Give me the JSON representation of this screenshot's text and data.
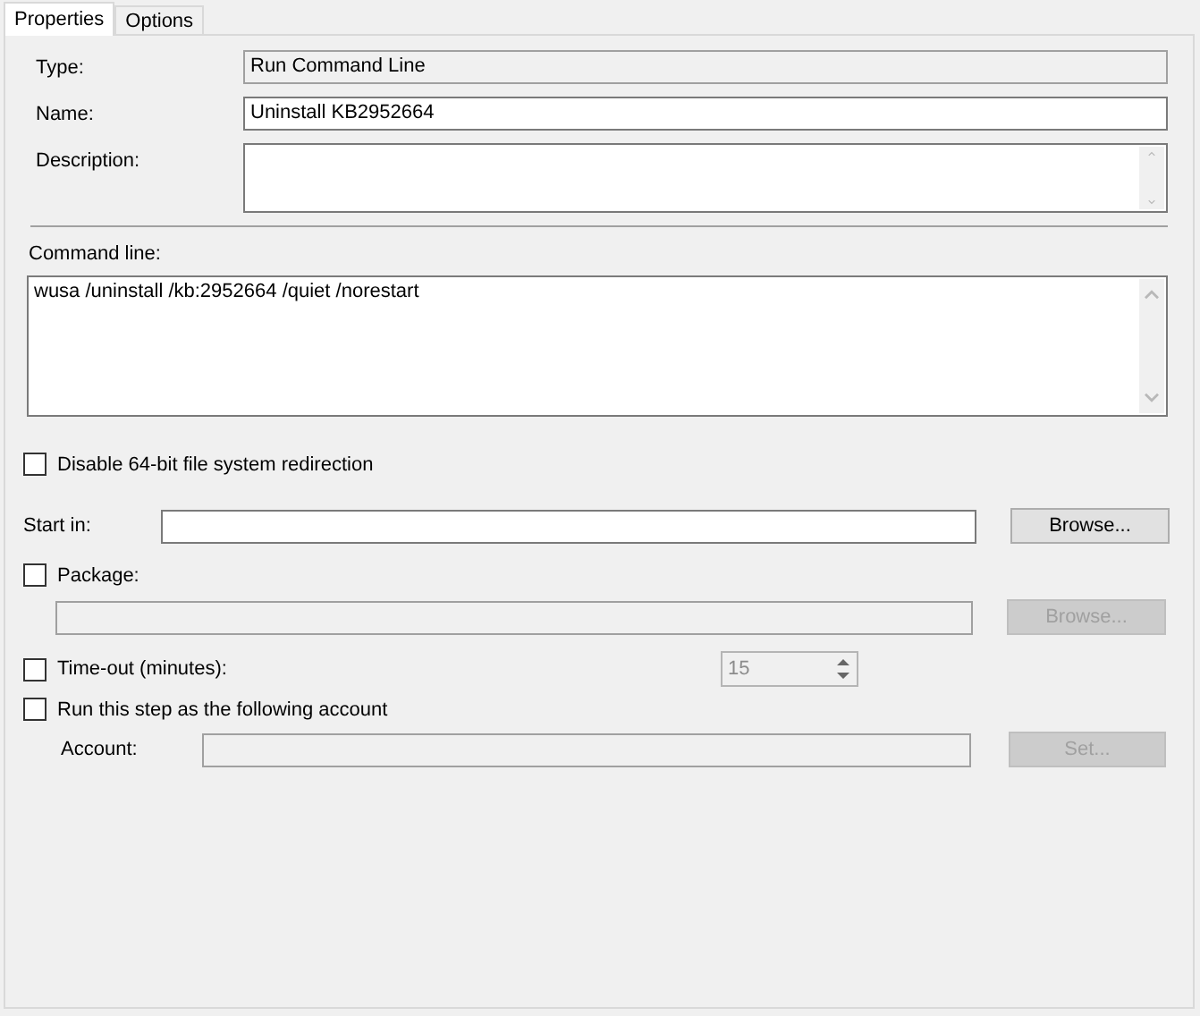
{
  "tabs": [
    {
      "label": "Properties",
      "selected": true
    },
    {
      "label": "Options",
      "selected": false
    }
  ],
  "type": {
    "label": "Type:",
    "value": "Run Command Line",
    "disabled": true
  },
  "name": {
    "label": "Name:",
    "value": "Uninstall KB2952664",
    "disabled": false
  },
  "description": {
    "label": "Description:"
  },
  "command_line": {
    "label": "Command line:",
    "value": "wusa /uninstall /kb:2952664 /quiet /norestart"
  },
  "disable_redirection": {
    "label": "Disable 64-bit file system redirection",
    "checked": false
  },
  "start_in": {
    "label": "Start in:",
    "button": "Browse...",
    "disabled": false
  },
  "package": {
    "label": "Package:",
    "checked": false,
    "button": "Browse...",
    "disabled": true
  },
  "timeout": {
    "label": "Time-out (minutes):",
    "checked": false,
    "value": "15",
    "disabled": true
  },
  "run_as": {
    "label": "Run this step as the following account",
    "checked": false
  },
  "account": {
    "label": "Account:",
    "button": "Set...",
    "disabled": true
  }
}
